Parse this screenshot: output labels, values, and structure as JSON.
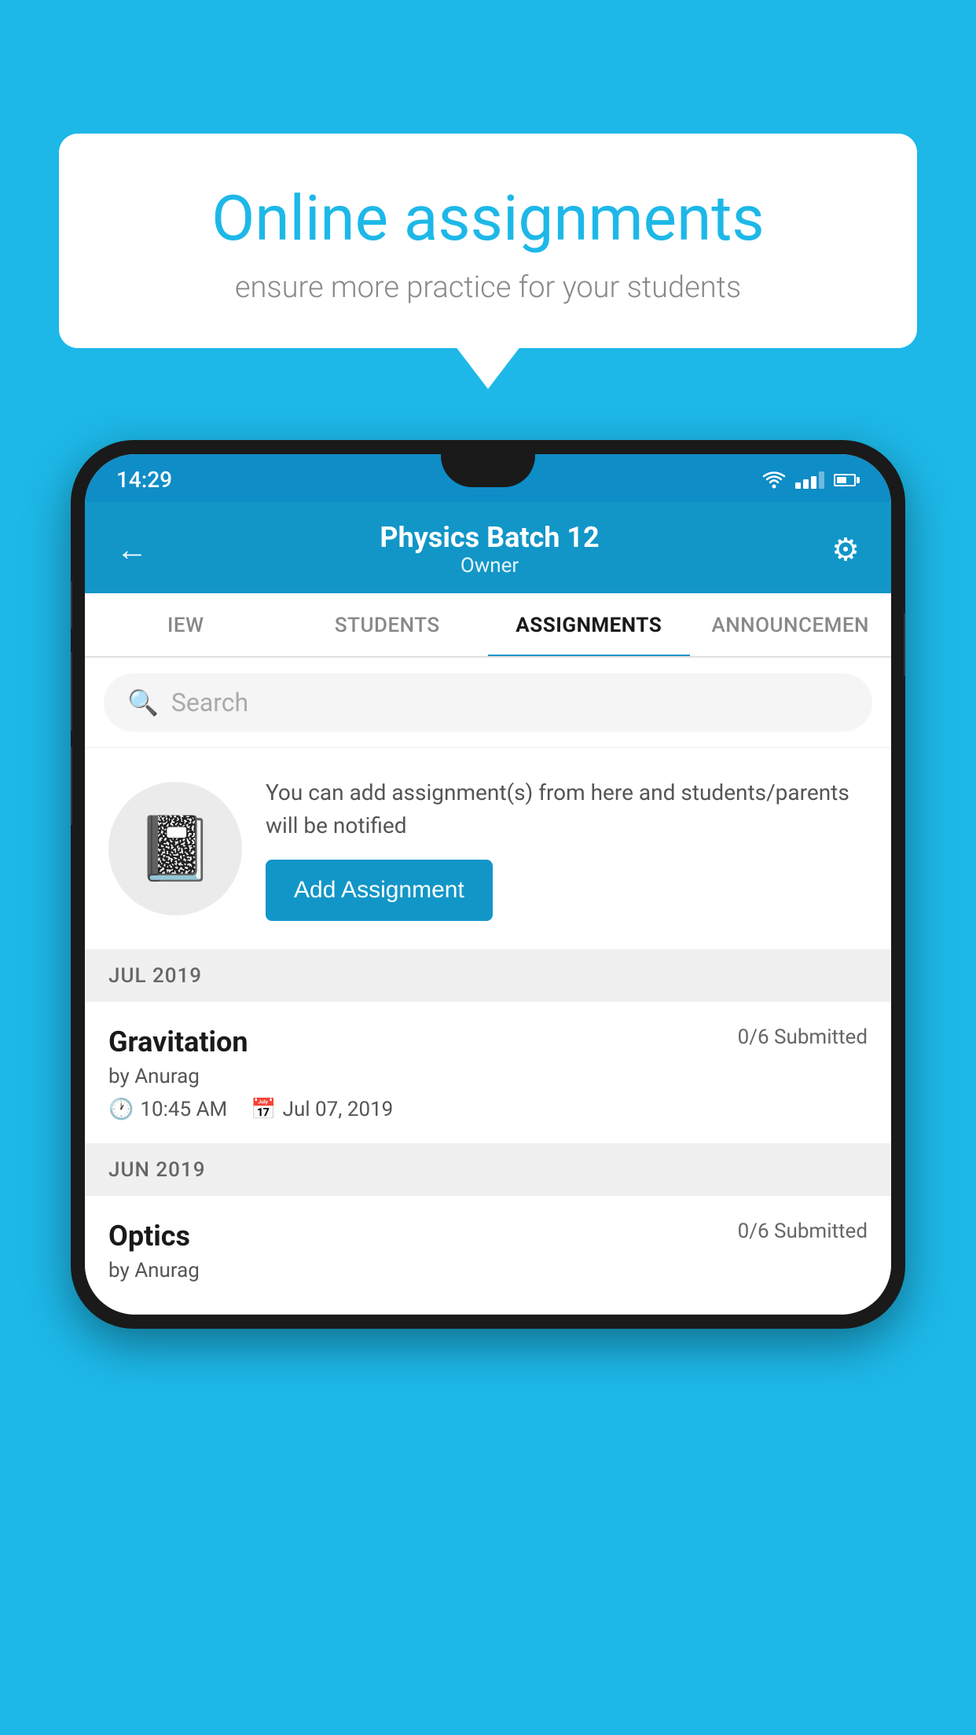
{
  "background_color": "#1DB8E8",
  "speech_bubble": {
    "title": "Online assignments",
    "subtitle": "ensure more practice for your students"
  },
  "status_bar": {
    "time": "14:29"
  },
  "app_header": {
    "title": "Physics Batch 12",
    "subtitle": "Owner",
    "back_label": "←",
    "gear_label": "⚙"
  },
  "tabs": [
    {
      "label": "IEW",
      "active": false
    },
    {
      "label": "STUDENTS",
      "active": false
    },
    {
      "label": "ASSIGNMENTS",
      "active": true
    },
    {
      "label": "ANNOUNCEMENTS",
      "active": false
    }
  ],
  "search": {
    "placeholder": "Search"
  },
  "promo": {
    "text": "You can add assignment(s) from here and students/parents will be notified",
    "button_label": "Add Assignment"
  },
  "sections": [
    {
      "header": "JUL 2019",
      "assignments": [
        {
          "name": "Gravitation",
          "submitted": "0/6 Submitted",
          "by": "by Anurag",
          "time": "10:45 AM",
          "date": "Jul 07, 2019"
        }
      ]
    },
    {
      "header": "JUN 2019",
      "assignments": [
        {
          "name": "Optics",
          "submitted": "0/6 Submitted",
          "by": "by Anurag",
          "time": "",
          "date": ""
        }
      ]
    }
  ]
}
